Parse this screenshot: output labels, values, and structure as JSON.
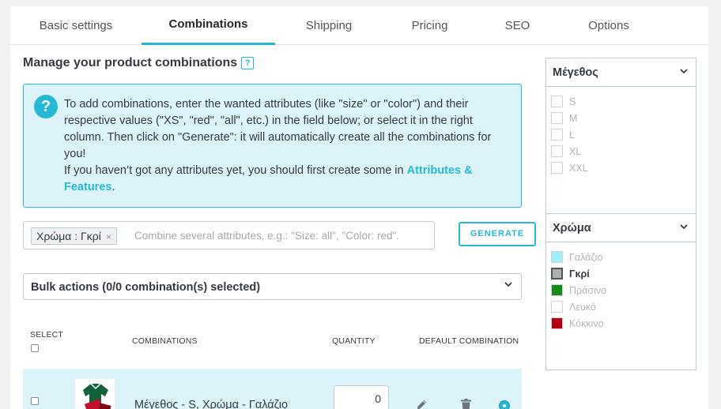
{
  "tabs": [
    {
      "label": "Basic settings"
    },
    {
      "label": "Combinations"
    },
    {
      "label": "Shipping"
    },
    {
      "label": "Pricing"
    },
    {
      "label": "SEO"
    },
    {
      "label": "Options"
    }
  ],
  "main": {
    "title": "Manage your product combinations",
    "help_badge": "?",
    "info": {
      "icon": "?",
      "text_line1": "To add combinations, enter the wanted attributes (like \"size\" or \"color\") and their respective values (\"XS\", \"red\", \"all\", etc.) in the field below; or select it in the right column. Then click on \"Generate\": it will automatically create all the combinations for you!",
      "text_line2_prefix": "If you haven’t got any attributes yet, you should first create some in ",
      "link": "Attributes & Features",
      "text_line2_suffix": "."
    },
    "attributes_input": {
      "tag": "Χρώμα : Γκρί",
      "tag_remove": "×",
      "placeholder": "Combine several attributes, e.g.: \"Size: all\", \"Color: red\"."
    },
    "generate_button": "GENERATE",
    "bulk_actions": {
      "label": "Bulk actions (0/0 combination(s) selected)",
      "chevron": "⌄"
    },
    "table": {
      "headers": {
        "select": "SELECT",
        "combinations": "COMBINATIONS",
        "quantity": "QUANTITY",
        "default": "DEFAULT COMBINATION"
      },
      "rows": [
        {
          "name": "Μέγεθος - S, Χρώμα - Γαλάζιο",
          "quantity": "0",
          "is_default": true,
          "edit_icon": "pencil-icon",
          "delete_icon": "trash-icon"
        }
      ]
    }
  },
  "sidebar": {
    "size": {
      "title": "Μέγεθος",
      "options": [
        {
          "label": "S"
        },
        {
          "label": "M"
        },
        {
          "label": "L"
        },
        {
          "label": "XL"
        },
        {
          "label": "XXL"
        }
      ]
    },
    "color": {
      "title": "Χρώμα",
      "options": [
        {
          "label": "Γαλάζιο",
          "swatch": "#9ff0fa",
          "selected": false
        },
        {
          "label": "Γκρί",
          "swatch": "#aab0b3",
          "selected": true
        },
        {
          "label": "Πράσινο",
          "swatch": "#138a13",
          "selected": false
        },
        {
          "label": "Λευκό",
          "swatch": "#ffffff",
          "selected": false
        },
        {
          "label": "Κόκκινο",
          "swatch": "#b00010",
          "selected": false
        }
      ]
    }
  },
  "colors": {
    "accent": "#25b9d7",
    "info_bg": "#dcf4f9"
  }
}
